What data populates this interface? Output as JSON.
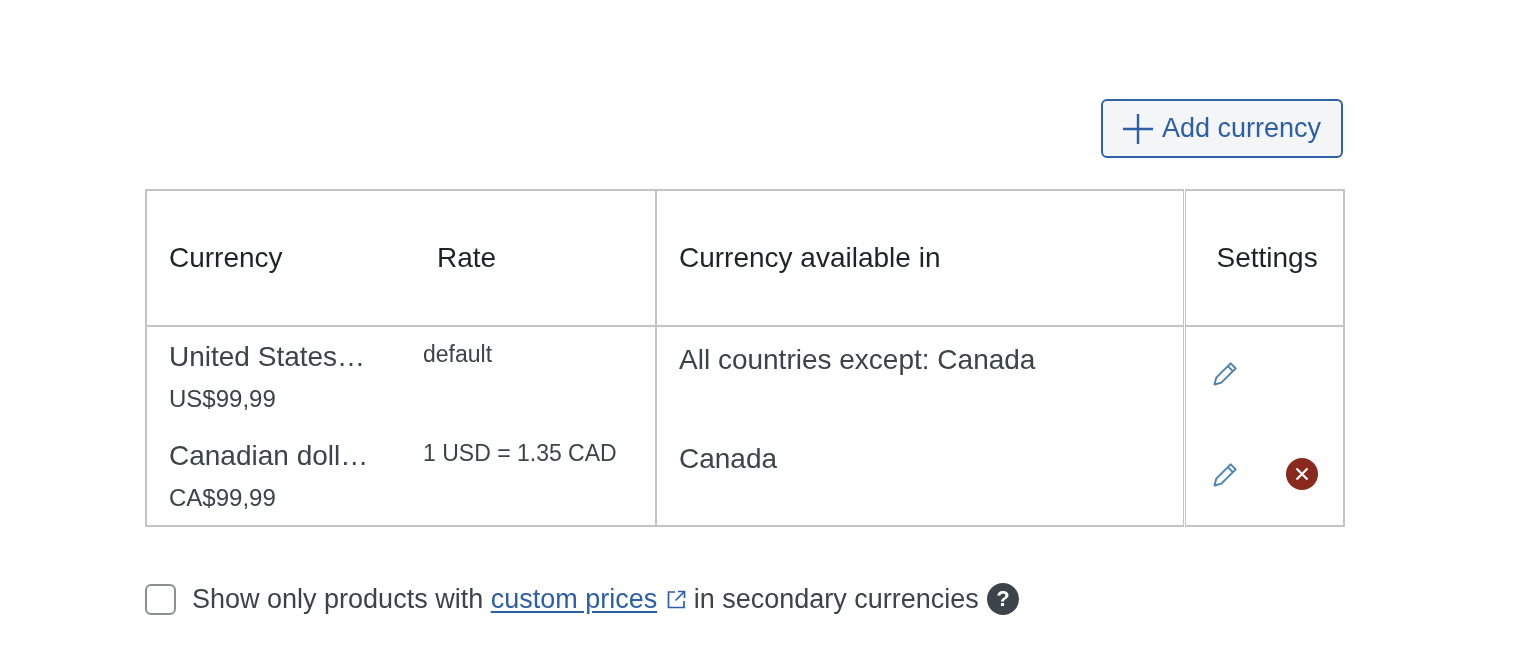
{
  "toolbar": {
    "add_button": {
      "label": "Add currency"
    }
  },
  "table": {
    "columns": [
      "Currency",
      "Rate",
      "Currency available in",
      "Settings"
    ],
    "rows": [
      {
        "currency": "United States…",
        "price": "US$99,99",
        "rate": "default",
        "available_in": "All countries except: Canada",
        "removable": false
      },
      {
        "currency": "Canadian doll…",
        "price": "CA$99,99",
        "rate": "1 USD = 1.35 CAD",
        "available_in": "Canada",
        "removable": true
      }
    ]
  },
  "filter": {
    "checked": false,
    "text_before": "Show only products with",
    "link": "custom prices",
    "text_after": "in secondary currencies",
    "help": "?"
  }
}
